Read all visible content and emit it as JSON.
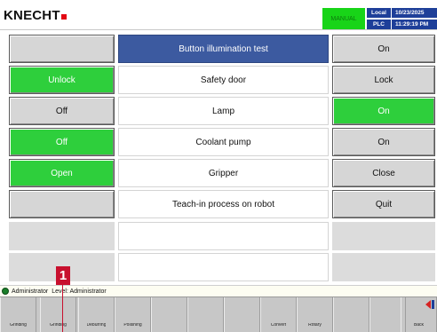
{
  "header": {
    "logo": "KNECHT",
    "mode": "MANUAL",
    "status": [
      "Local",
      "PLC"
    ],
    "date": "10/23/2025",
    "time": "11:29:19 PM"
  },
  "rows": [
    {
      "label": "Button illumination test",
      "left": "",
      "right": "On"
    },
    {
      "label": "Safety door",
      "left": "Unlock",
      "right": "Lock"
    },
    {
      "label": "Lamp",
      "left": "Off",
      "right": "On"
    },
    {
      "label": "Coolant pump",
      "left": "Off",
      "right": "On"
    },
    {
      "label": "Gripper",
      "left": "Open",
      "right": "Close"
    },
    {
      "label": "Teach-in process on robot",
      "left": "",
      "right": "Quit"
    }
  ],
  "userbar": {
    "user": "Administrator",
    "level": "Level: Administrator"
  },
  "callout": "1",
  "softkeys": [
    "Grinding",
    "Grinding",
    "Deburring",
    "Polishing",
    "",
    "",
    "",
    "Convert",
    "Rotary",
    "",
    "",
    "Back"
  ]
}
